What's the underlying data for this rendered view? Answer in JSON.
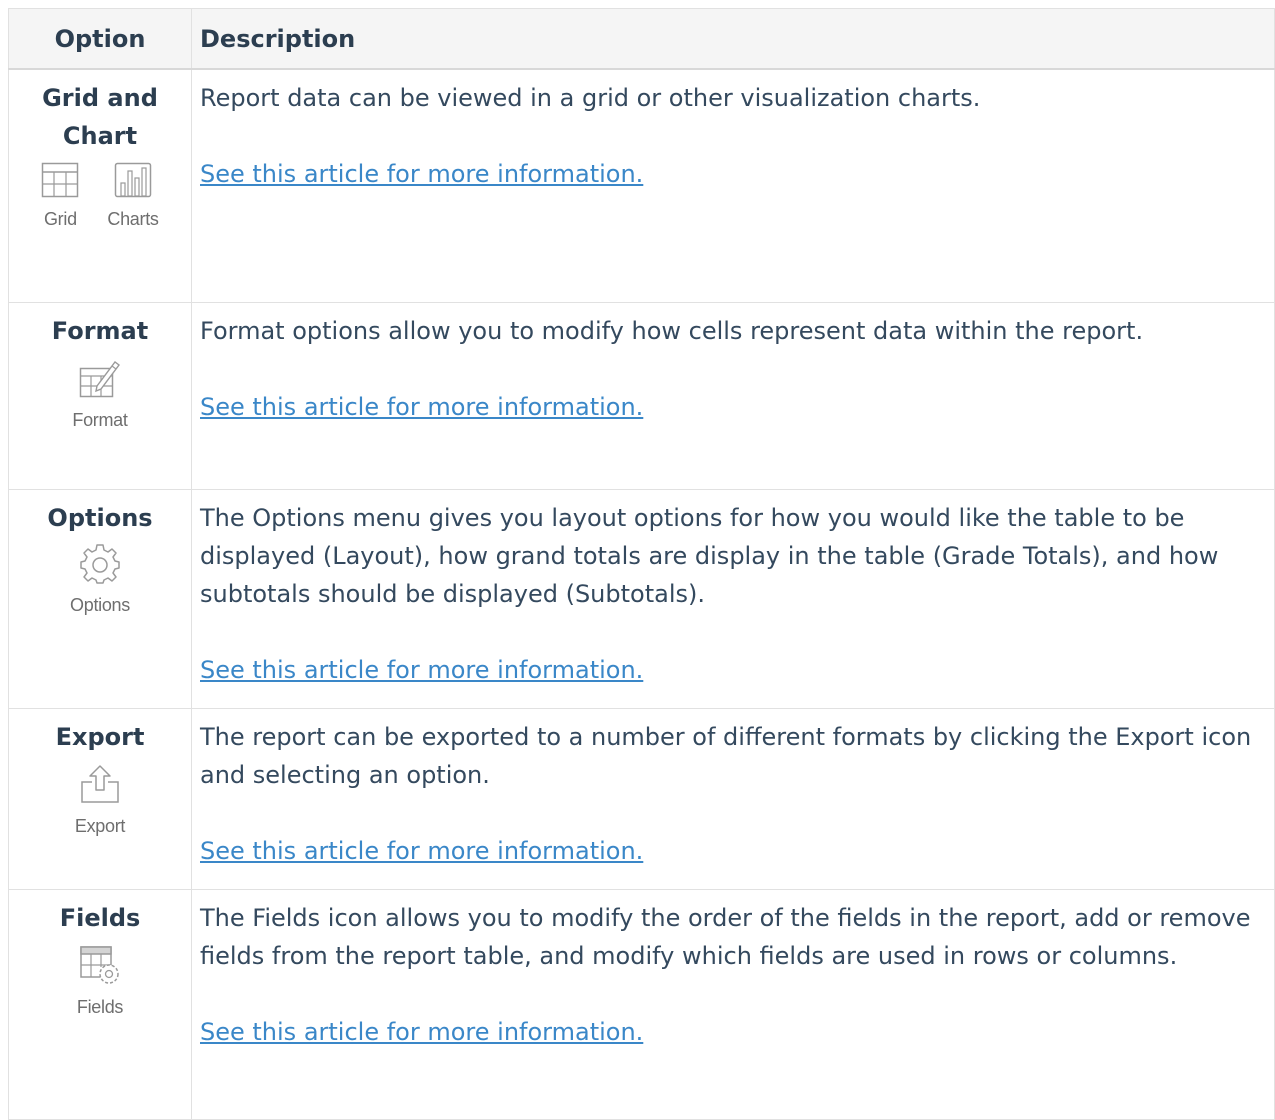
{
  "table": {
    "headers": {
      "option": "Option",
      "description": "Description"
    },
    "link_text": "See this article for more information.",
    "rows": [
      {
        "title": "Grid and Chart",
        "icons": [
          {
            "icon": "grid-icon",
            "label": "Grid"
          },
          {
            "icon": "bar-chart-icon",
            "label": "Charts"
          }
        ],
        "description": [
          "Report data can be viewed in a grid or other visualization charts."
        ]
      },
      {
        "title": "Format",
        "icons": [
          {
            "icon": "format-icon",
            "label": "Format"
          }
        ],
        "description": [
          "Format options allow you to modify how cells represent data within the report."
        ]
      },
      {
        "title": "Options",
        "icons": [
          {
            "icon": "gear-icon",
            "label": "Options"
          }
        ],
        "description": [
          "The Options menu gives you layout options for how you would like the table to be displayed (Layout), how grand totals are display in the table (Grade Totals), and how subtotals should be displayed (Subtotals)."
        ]
      },
      {
        "title": "Export",
        "icons": [
          {
            "icon": "export-icon",
            "label": "Export"
          }
        ],
        "description": [
          "The report can be exported to a number of different formats by clicking the Export icon and selecting an option."
        ]
      },
      {
        "title": "Fields",
        "icons": [
          {
            "icon": "fields-icon",
            "label": "Fields"
          }
        ],
        "description": [
          "The Fields icon allows you to modify the order of the fields in the report, add or remove fields from the report table, and modify which fields are used in rows or columns."
        ]
      }
    ]
  },
  "colors": {
    "text": "#34495e",
    "heading": "#2c3e50",
    "link": "#3a87c8",
    "header_bg": "#f5f5f5",
    "border": "#e1e1e1",
    "icon": "#9a9a9a"
  }
}
